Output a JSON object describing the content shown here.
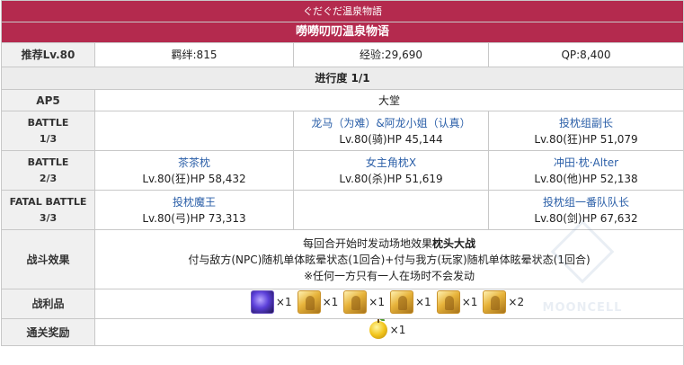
{
  "header": {
    "subtitle": "ぐだぐだ温泉物語",
    "title": "嘮嘮叨叨温泉物语"
  },
  "info": {
    "recommended_level": "推荐Lv.80",
    "bond": "羁绊:815",
    "exp": "经验:29,690",
    "qp": "QP:8,400"
  },
  "progress": "进行度 1/1",
  "ap": {
    "label": "AP5",
    "location": "大堂"
  },
  "battles": [
    {
      "label": "BATTLE",
      "num": "1/3",
      "enemies": [
        {
          "name": "",
          "stats": ""
        },
        {
          "name": "龙马（为难）&阿龙小姐（认真）",
          "stats": "Lv.80(骑)HP 45,144"
        },
        {
          "name": "投枕组副长",
          "stats": "Lv.80(狂)HP 51,079"
        }
      ]
    },
    {
      "label": "BATTLE",
      "num": "2/3",
      "enemies": [
        {
          "name": "茶茶枕",
          "stats": "Lv.80(狂)HP 58,432"
        },
        {
          "name": "女主角枕X",
          "stats": "Lv.80(杀)HP 51,619"
        },
        {
          "name": "冲田·枕·Alter",
          "stats": "Lv.80(他)HP 52,138"
        }
      ]
    },
    {
      "label": "FATAL BATTLE",
      "num": "3/3",
      "enemies": [
        {
          "name": "投枕魔王",
          "stats": "Lv.80(弓)HP 73,313"
        },
        {
          "name": "",
          "stats": ""
        },
        {
          "name": "投枕组一番队队长",
          "stats": "Lv.80(剑)HP 67,632"
        }
      ]
    }
  ],
  "effect": {
    "label": "战斗效果",
    "line1_prefix": "每回合开始时发动场地效果",
    "line1_bold": "枕头大战",
    "line2": "付与敌方(NPC)随机单体眩晕状态(1回合)+付与我方(玩家)随机单体眩晕状态(1回合)",
    "line3": "※任何一方只有一人在场时不会发动"
  },
  "drops": {
    "label": "战利品",
    "items": [
      {
        "icon": "purple-gem-icon",
        "count": "×1"
      },
      {
        "icon": "gold-statue-icon",
        "count": "×1"
      },
      {
        "icon": "gold-statue-icon",
        "count": "×1"
      },
      {
        "icon": "gold-statue-icon",
        "count": "×1"
      },
      {
        "icon": "gold-statue-icon",
        "count": "×1"
      },
      {
        "icon": "gold-statue-icon",
        "count": "×2"
      }
    ]
  },
  "reward": {
    "label": "通关奖励",
    "icon": "golden-apple-icon",
    "count": "×1"
  },
  "watermark": "MOONCELL",
  "colors": {
    "header_bg": "#b42a4e",
    "link": "#2b5fa8",
    "label_bg": "#f0f0f0"
  }
}
